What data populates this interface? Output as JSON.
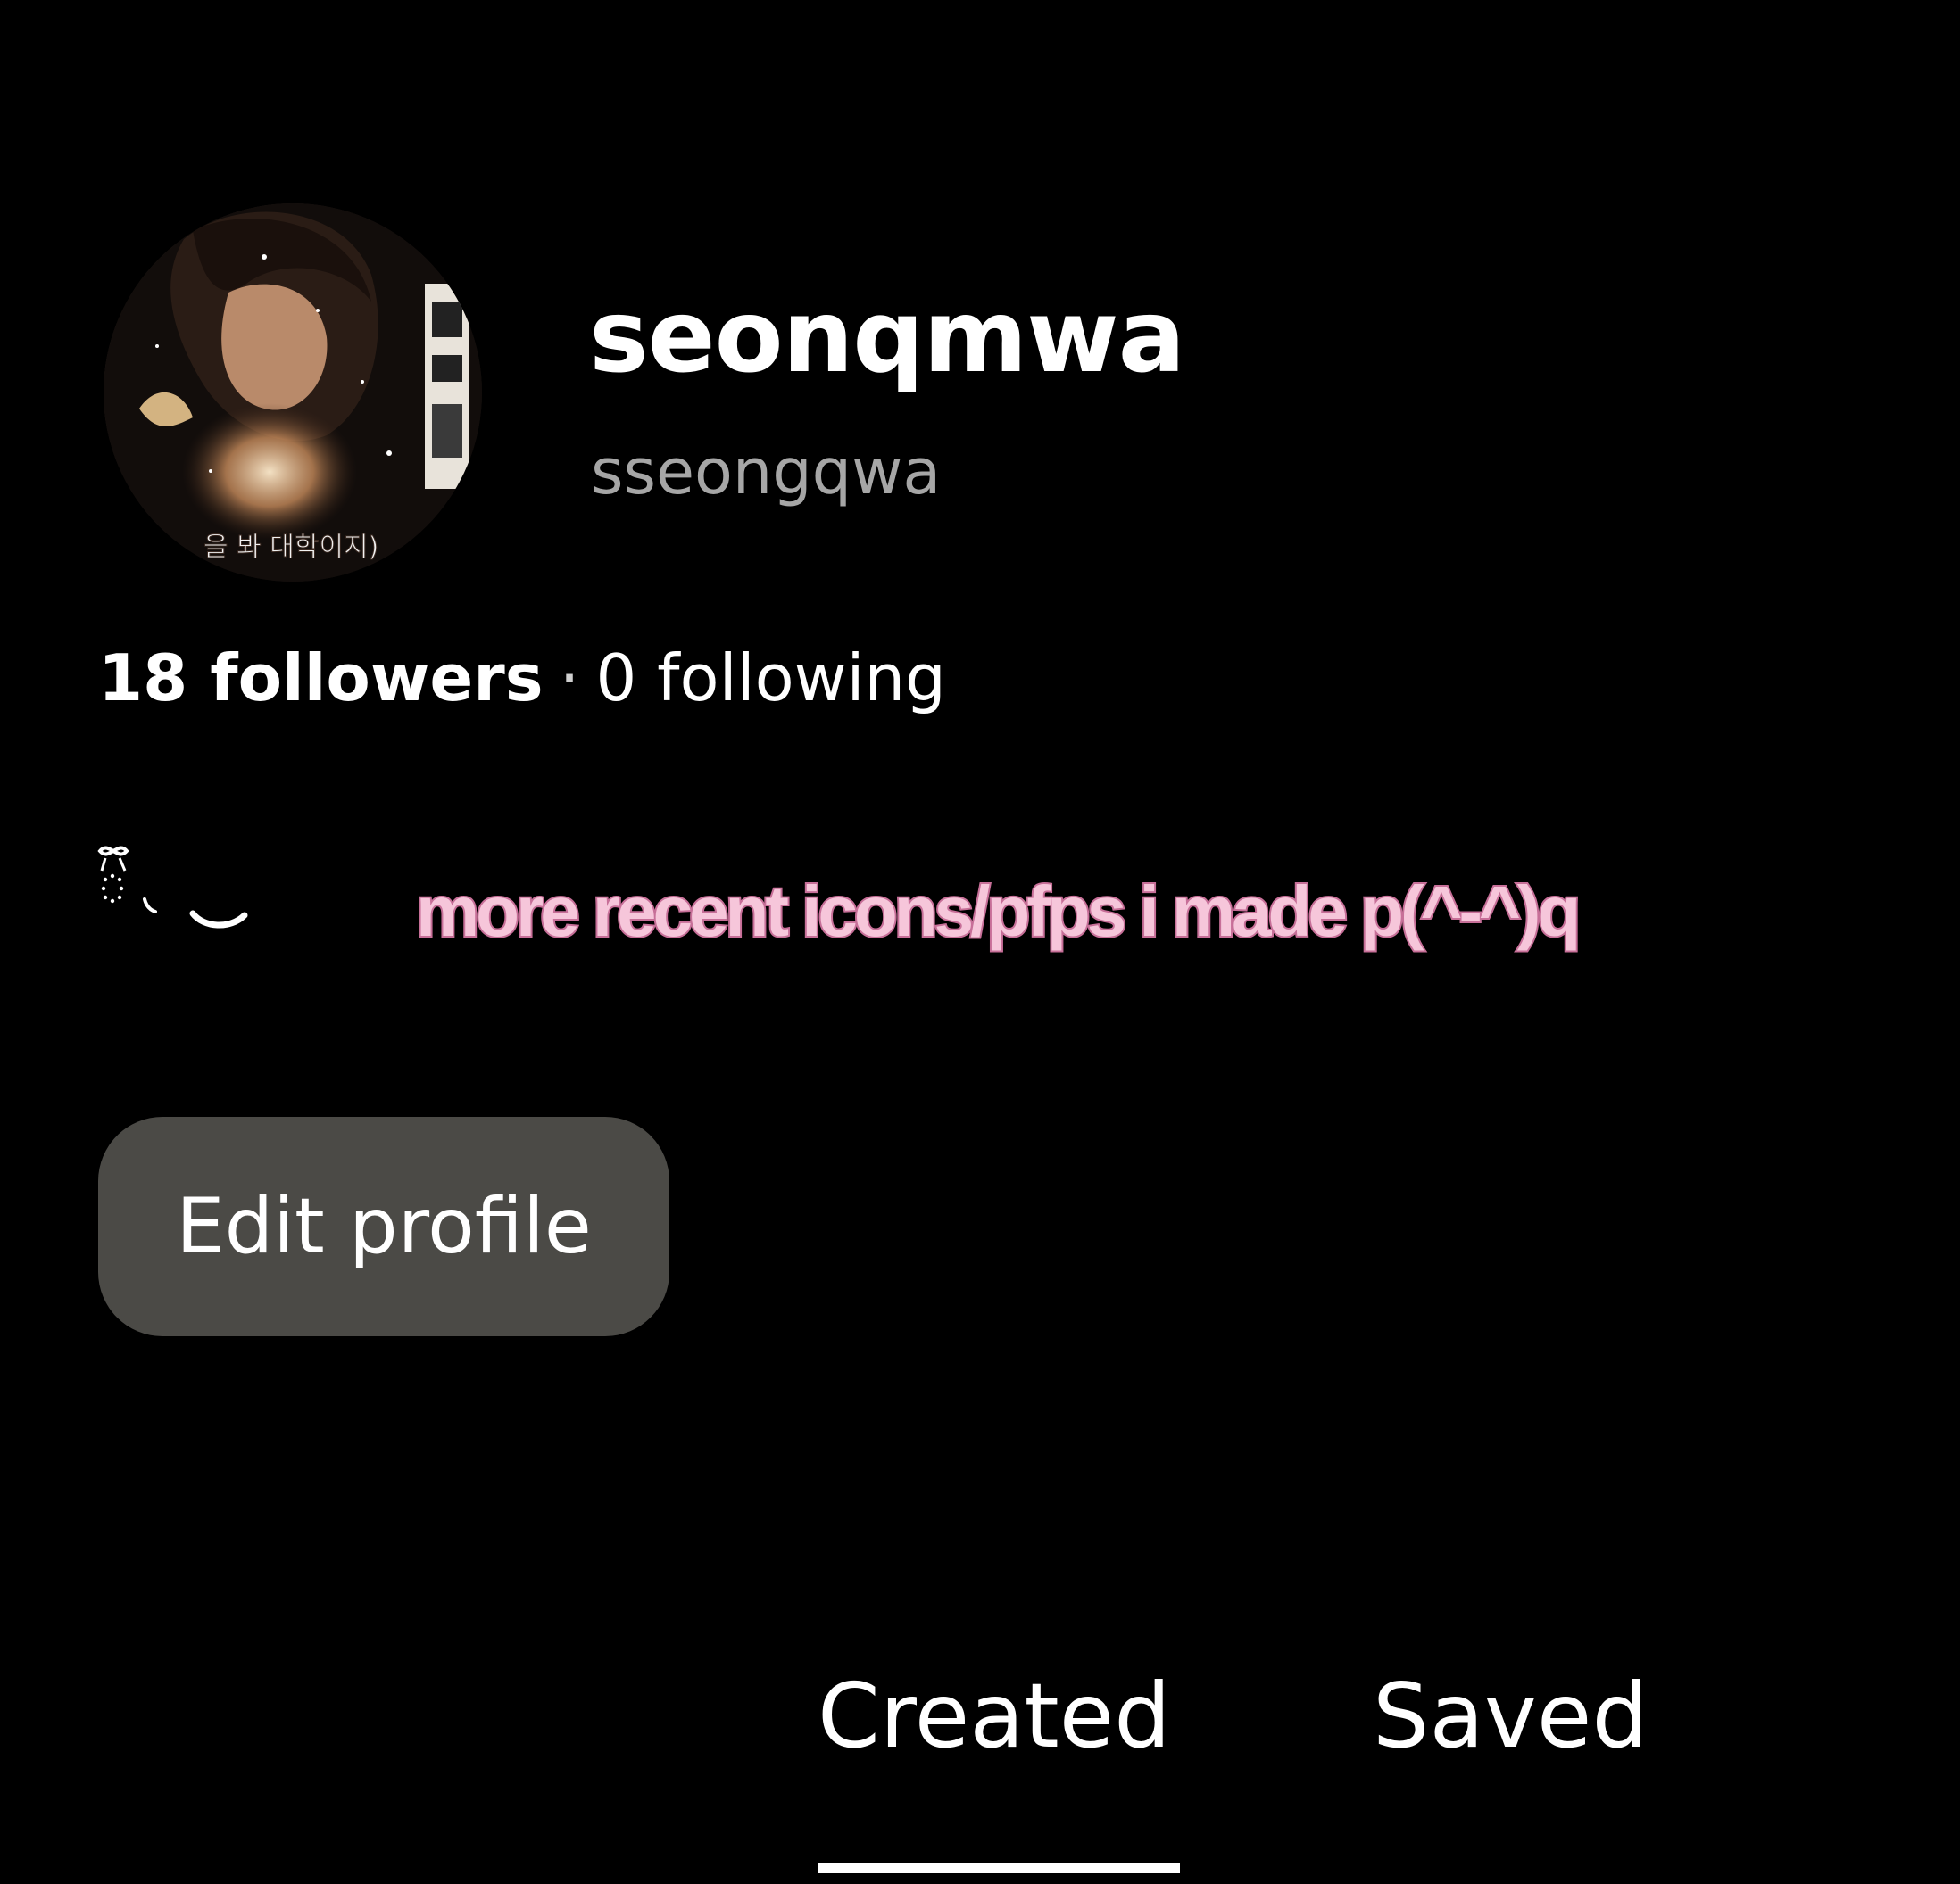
{
  "profile": {
    "display_name": "seonqmwa",
    "username": "sseongqwa",
    "avatar_caption": "을 봐 대학이지)",
    "followers_label": "18 followers",
    "separator": "·",
    "following_label": "0 following",
    "bio": "more recent icons/pfps i made p(^-^)q"
  },
  "actions": {
    "edit_label": "Edit profile"
  },
  "tabs": [
    {
      "label": "Created",
      "active": true
    },
    {
      "label": "Saved",
      "active": false
    }
  ],
  "colors": {
    "background": "#000000",
    "username_gray": "#a6a6a6",
    "button_bg": "#4b4a46",
    "bio_fill": "#f6c6da",
    "bio_outline": "#c76f98"
  }
}
